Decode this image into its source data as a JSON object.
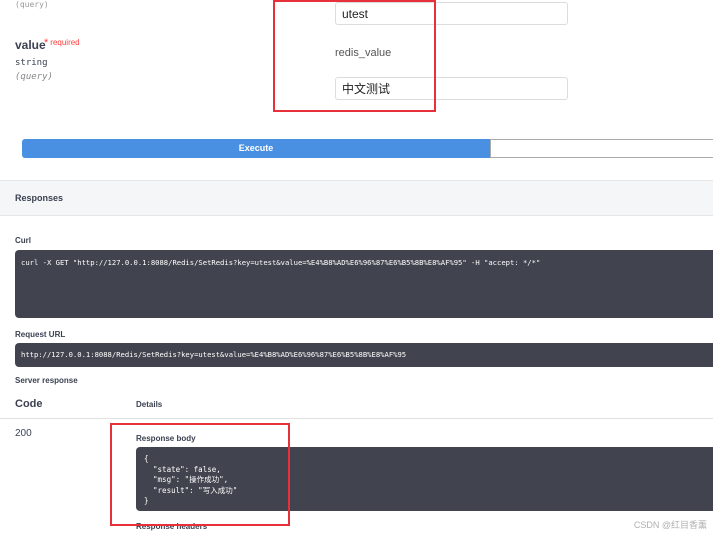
{
  "params": {
    "value_name": "value",
    "required_label": "required",
    "value_type": "string",
    "value_in": "(query)"
  },
  "inputs": {
    "key_value": "utest",
    "key_example": "redis_value",
    "value_value": "中文测试"
  },
  "execute": {
    "label": "Execute"
  },
  "responses": {
    "title": "Responses",
    "curl_label": "Curl",
    "curl_command": "curl -X GET \"http://127.0.0.1:8088/Redis/SetRedis?key=utest&value=%E4%B8%AD%E6%96%87%E6%B5%8B%E8%AF%95\" -H \"accept: */*\"",
    "request_url_label": "Request URL",
    "request_url": "http://127.0.0.1:8088/Redis/SetRedis?key=utest&value=%E4%B8%AD%E6%96%87%E6%B5%8B%E8%AF%95",
    "server_response_label": "Server response",
    "code_header": "Code",
    "details_header": "Details",
    "code": "200",
    "response_body_label": "Response body",
    "response_body": "{\n  \"state\": false,\n  \"msg\": \"操作成功\",\n  \"result\": \"写入成功\"\n}",
    "response_headers_label": "Response headers"
  },
  "watermark": "CSDN @红目香薰",
  "colors": {
    "execute": "#4990e2",
    "highlight": "#e8303b",
    "code_bg": "#41444e",
    "required": "#ff3e3e"
  }
}
